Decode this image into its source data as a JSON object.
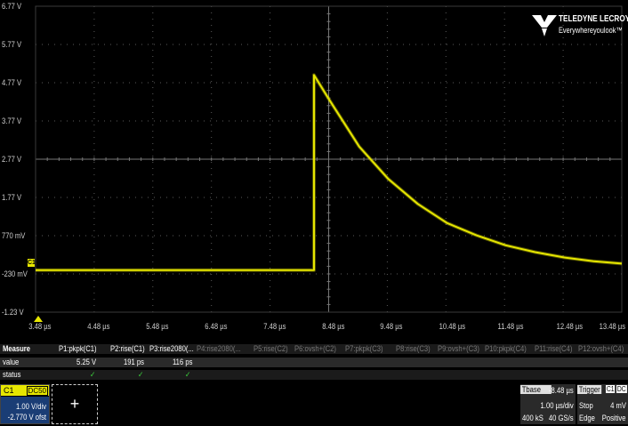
{
  "logo": {
    "brand": "TELEDYNE LECROY",
    "tagline": "Everywhereyoulook™"
  },
  "y_axis_labels": [
    "6.77 V",
    "5.77 V",
    "4.77 V",
    "3.77 V",
    "2.77 V",
    "1.77 V",
    "770 mV",
    "-230 mV",
    "-1.23 V"
  ],
  "x_axis_labels": [
    "3.48 µs",
    "4.48 µs",
    "5.48 µs",
    "6.48 µs",
    "7.48 µs",
    "8.48 µs",
    "9.48 µs",
    "10.48 µs",
    "11.48 µs",
    "12.48 µs",
    "13.48 µs"
  ],
  "channel_marker": "C1",
  "colors": {
    "trace": "#e6e600",
    "grid": "#5a5a5a",
    "check": "#3cd23c",
    "channel_selected": "#1a3d75"
  },
  "chart_data": {
    "type": "line",
    "xlabel": "",
    "ylabel": "",
    "xlim": [
      3.48,
      13.48
    ],
    "ylim": [
      -1.23,
      6.77
    ],
    "x_unit": "µs",
    "y_unit": "V",
    "series": [
      {
        "x": [
          3.48,
          8.23,
          8.23,
          8.5,
          9.0,
          9.5,
          10.0,
          10.5,
          11.0,
          11.5,
          12.0,
          12.5,
          13.0,
          13.48
        ],
        "y": [
          -0.13,
          -0.13,
          4.97,
          4.3,
          3.1,
          2.25,
          1.6,
          1.1,
          0.78,
          0.52,
          0.34,
          0.2,
          0.1,
          0.04
        ]
      }
    ]
  },
  "measure": {
    "headers": [
      "Measure",
      "P1:pkpk(C1)",
      "P2:rise(C1)",
      "P3:rise2080(...",
      "P4:rise2080(...",
      "P5:rise(C2)",
      "P6:ovsh+(C2)",
      "P7:pkpk(C3)",
      "P8:rise(C3)",
      "P9:ovsh+(C3)",
      "P10:pkpk(C4)",
      "P11:rise(C4)",
      "P12:ovsh+(C4)"
    ],
    "value_label": "value",
    "values": [
      "5.25 V",
      "191 ps",
      "116 ps"
    ],
    "status_label": "status",
    "status": [
      "✓",
      "✓",
      "✓"
    ]
  },
  "channel": {
    "name": "C1",
    "coupling": "DC50",
    "vdiv": "1.00 V/div",
    "offset": "-2.770 V ofst"
  },
  "add_button": "+",
  "timebase": {
    "label": "Tbase",
    "delay": "-8.48 µs",
    "tdiv": "1.00 µs/div",
    "samples": "400 kS",
    "rate": "40 GS/s"
  },
  "trigger": {
    "label": "Trigger",
    "source": "C1",
    "coupling": "DC",
    "mode": "Stop",
    "level": "4 mV",
    "type": "Edge",
    "slope": "Positive"
  }
}
